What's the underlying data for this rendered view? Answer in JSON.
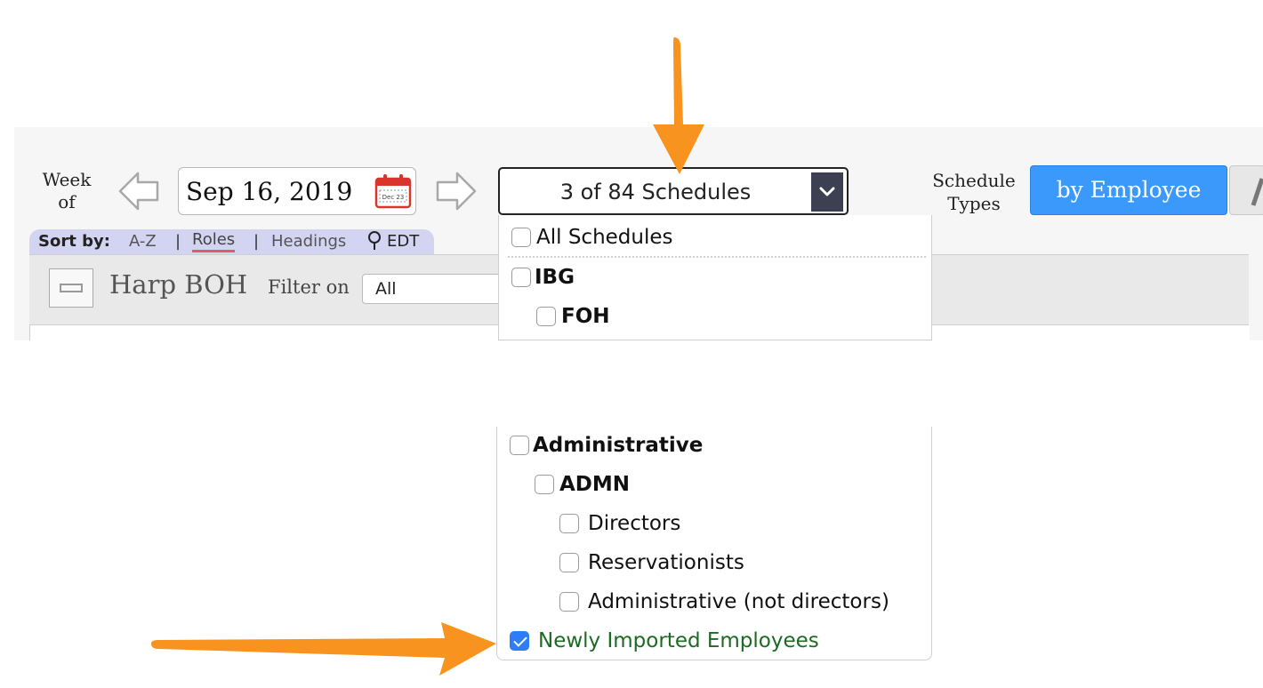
{
  "toolbar": {
    "week_label_1": "Week",
    "week_label_2": "of",
    "date": "Sep 16, 2019",
    "calendar_mini_text": "Dec 23",
    "schedules_selector": "3 of 84 Schedules",
    "schedule_types_label_1": "Schedule",
    "schedule_types_label_2": "Types",
    "schedule_type_selected": "by Employee"
  },
  "sort_bar": {
    "label": "Sort by:",
    "options": [
      "A-Z",
      "Roles",
      "Headings"
    ],
    "active": "Roles",
    "separator": "|",
    "timezone": "EDT"
  },
  "schedule_header": {
    "title": "Harp BOH",
    "filter_label": "Filter on",
    "filter_value": "All"
  },
  "schedule_dropdown": {
    "all": {
      "label": "All Schedules",
      "checked": false
    },
    "ibg": {
      "label": "IBG",
      "checked": false
    },
    "foh": {
      "label": "FOH",
      "checked": false
    },
    "administrative": {
      "label": "Administrative",
      "checked": false
    },
    "admn": {
      "label": "ADMN",
      "checked": false
    },
    "directors": {
      "label": "Directors",
      "checked": false
    },
    "reservationists": {
      "label": "Reservationists",
      "checked": false
    },
    "admin_not_directors": {
      "label": "Administrative (not directors)",
      "checked": false
    },
    "newly_imported": {
      "label": "Newly Imported Employees",
      "checked": true
    }
  },
  "colors": {
    "accent_blue": "#3b99fc",
    "annotation_orange": "#f7931e",
    "sort_bar_bg": "#d3d3f2",
    "active_sort_underline": "#e45a6a",
    "newly_imported_text": "#1c6b22"
  }
}
